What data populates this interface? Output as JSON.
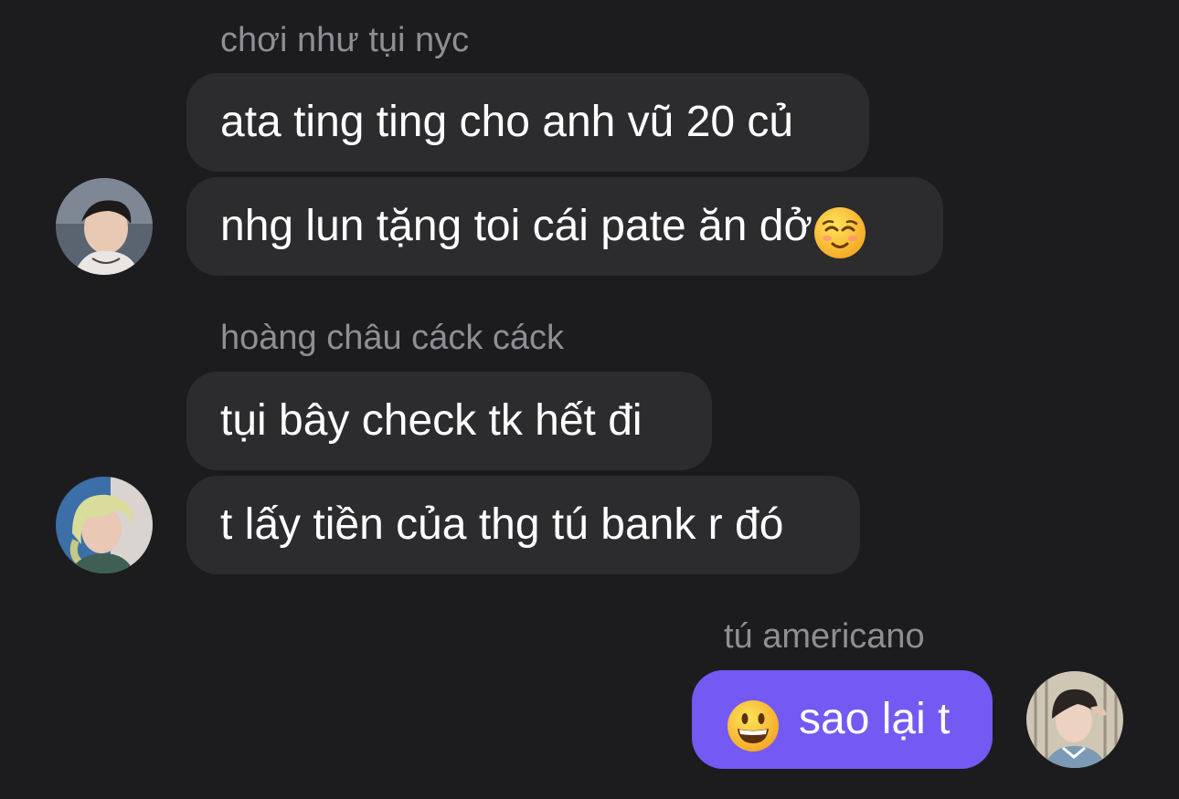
{
  "conversation": {
    "groups": [
      {
        "sender": "chơi như tụi nyc",
        "messages": [
          "ata ting ting cho anh vũ 20 củ",
          "nhg lun tặng toi cái pate ăn dở"
        ],
        "avatar": "user-avatar-photo"
      },
      {
        "sender": "hoàng châu cáck cáck",
        "messages": [
          "tụi bây check tk hết đi",
          "t lấy tiền của thg tú bank r đó"
        ],
        "avatar": "user-avatar-photo"
      },
      {
        "sender": "tú americano",
        "messages": [
          "sao lại t"
        ],
        "avatar": "own-avatar-photo",
        "mine": true
      }
    ]
  },
  "icons": {
    "smiling_emoji": "relieved-smile-emoji",
    "grinning_emoji": "grinning-face-emoji"
  },
  "colors": {
    "background": "#1c1c1e",
    "incoming_bubble": "#2c2c2e",
    "outgoing_bubble": "#7459f3",
    "sender_name": "#8e8e93",
    "message_text": "#ffffff"
  }
}
